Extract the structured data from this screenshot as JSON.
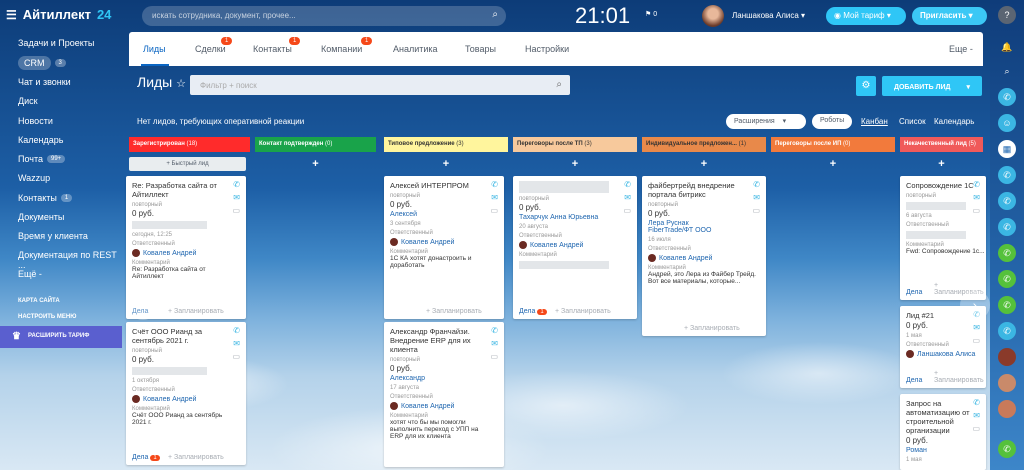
{
  "app": {
    "logo": "Айтиллект",
    "logo_num": "24"
  },
  "search": {
    "placeholder": "искать сотрудника, документ, прочее..."
  },
  "clock": "21:01",
  "flag": "0",
  "user": {
    "name": "Ланшакова Алиса"
  },
  "buttons": {
    "tariff": "Мой тариф",
    "invite": "Пригласить",
    "add_lead": "ДОБАВИТЬ ЛИД"
  },
  "menu": {
    "items": [
      {
        "label": "Задачи и Проекты",
        "badge": ""
      },
      {
        "label": "CRM",
        "badge": "3"
      },
      {
        "label": "Чат и звонки",
        "badge": ""
      },
      {
        "label": "Диск",
        "badge": ""
      },
      {
        "label": "Новости",
        "badge": ""
      },
      {
        "label": "Календарь",
        "badge": ""
      },
      {
        "label": "Почта",
        "badge": "99+"
      },
      {
        "label": "Wazzup",
        "badge": ""
      },
      {
        "label": "Контакты",
        "badge": "1"
      },
      {
        "label": "Документы",
        "badge": ""
      },
      {
        "label": "Время у клиента",
        "badge": ""
      },
      {
        "label": "Документация по REST ...",
        "badge": ""
      },
      {
        "label": "Ещё -",
        "badge": ""
      }
    ],
    "sitemap": "КАРТА САЙТА",
    "setup": "НАСТРОИТЬ МЕНЮ",
    "upgrade": "РАСШИРИТЬ ТАРИФ"
  },
  "tabs": [
    {
      "label": "Лиды",
      "badge": ""
    },
    {
      "label": "Сделки",
      "badge": "1"
    },
    {
      "label": "Контакты",
      "badge": "1"
    },
    {
      "label": "Компании",
      "badge": "1"
    },
    {
      "label": "Аналитика",
      "badge": ""
    },
    {
      "label": "Товары",
      "badge": ""
    },
    {
      "label": "Настройки",
      "badge": ""
    }
  ],
  "tabs_more": "Еще -",
  "page": {
    "title": "Лиды",
    "filter_placeholder": "Фильтр + поиск",
    "notice": "Нет лидов, требующих оперативной реакции"
  },
  "toolbar": {
    "extensions": "Расширения",
    "robots": "Роботы",
    "kanban": "Канбан",
    "list": "Список",
    "calendar": "Календарь"
  },
  "quick_lead": "+ Быстрый лид",
  "columns": [
    {
      "name": "Зарегистрирован",
      "count": "(18)",
      "color": "#ff2b2b"
    },
    {
      "name": "Контакт подтвержден",
      "count": "(0)",
      "color": "#19a34a"
    },
    {
      "name": "Типовое предложение",
      "count": "(3)",
      "color": "#fff59d"
    },
    {
      "name": "Переговоры после ТП",
      "count": "(3)",
      "color": "#f7c99c"
    },
    {
      "name": "Индивидуальное предложен...",
      "count": "(1)",
      "color": "#d9692a"
    },
    {
      "name": "Переговоры после ИП",
      "count": "(0)",
      "color": "#f27a3c"
    },
    {
      "name": "Некачественный лид",
      "count": "(5)",
      "color": "#f05a5a"
    }
  ],
  "labels": {
    "repeat": "повторный",
    "resp": "Ответственный",
    "comment": "Комментарий",
    "deals": "Дела",
    "plan": "+ Запланировать"
  },
  "cards": {
    "c1": {
      "title": "Re: Разработка сайта от Айтиллект",
      "sum": "0 руб.",
      "date": "сегодня, 12:25",
      "person": "Ковалев Андрей",
      "comment": "Re: Разработка сайта от Айтиллект"
    },
    "c2": {
      "title": "Счёт ООО Рианд за сентябрь 2021 г.",
      "sum": "0 руб.",
      "date": "1 октября",
      "person": "Ковалев Андрей",
      "comment": "Счёт ООО Рианд за сентябрь 2021 г.",
      "deals_badge": "1"
    },
    "c3": {
      "title": "Алексей ИНТЕРПРОМ",
      "sum": "0 руб.",
      "contact": "Алексей",
      "date": "3 сентября",
      "person": "Ковалев Андрей",
      "comment": "1С КА хотят донастроить и доработать"
    },
    "c4": {
      "title": "Александр Франчайзи. Внедрение ERP для их клиента",
      "sum": "0 руб.",
      "contact": "Александр",
      "date": "17 августа",
      "person": "Ковалев Андрей",
      "comment": "хотят что бы мы помогли выполнить переход с УПП на ERP для их клиента"
    },
    "c5": {
      "sum": "0 руб.",
      "contact": "Тахарчук Анна Юрьевна",
      "date": "20 августа",
      "person": "Ковалев Андрей",
      "deals_badge": "1"
    },
    "c6": {
      "title": "файбертрейд внедрение портала битрикс",
      "sum": "0 руб.",
      "contact": "Лера Руснак",
      "company": "FiberTrade/ФТ ООО",
      "date": "16 июля",
      "person": "Ковалев Андрей",
      "comment": "Андрей, это Лера из Файбер Трейд. Вот все материалы, которые..."
    },
    "c7": {
      "title": "Сопровождение 1С",
      "date": "6 августа",
      "comment": "Fwd: Сопровождение 1с..."
    },
    "c8": {
      "title": "Лид #21",
      "sum": "0 руб.",
      "date": "1 мая",
      "person": "Ланшакова Алиса"
    },
    "c9": {
      "title": "Запрос на автоматизацию от строительной организации",
      "sum": "0 руб.",
      "contact": "Роман",
      "date": "1 мая"
    }
  }
}
